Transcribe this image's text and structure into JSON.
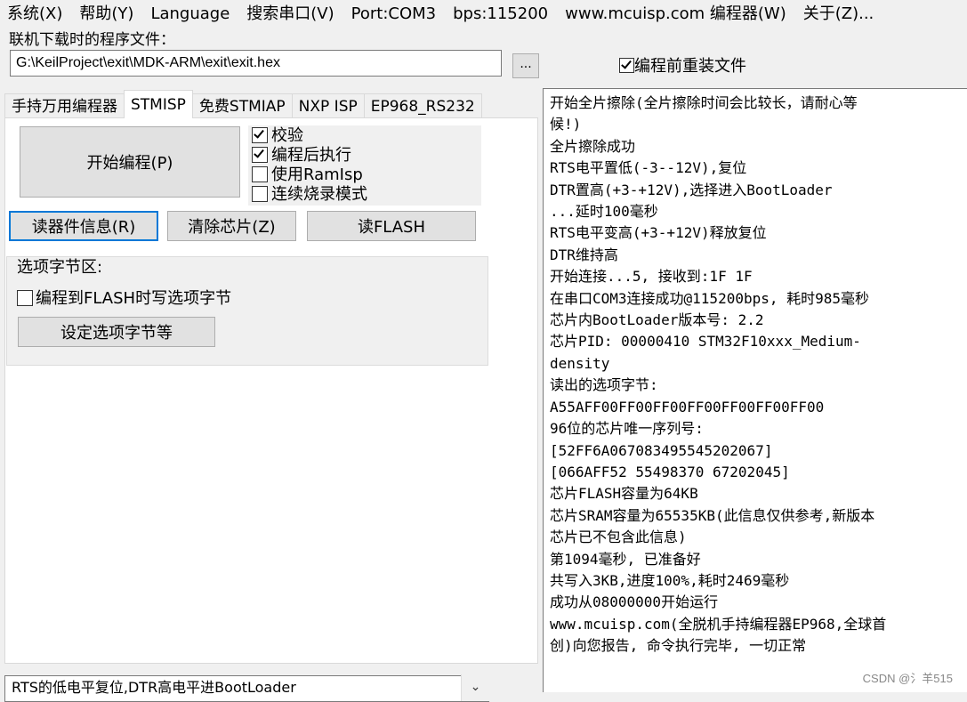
{
  "menu": [
    "系统(X)",
    "帮助(Y)",
    "Language",
    "搜索串口(V)",
    "Port:COM3",
    "bps:115200",
    "www.mcuisp.com 编程器(W)",
    "关于(Z)..."
  ],
  "file": {
    "label": "联机下载时的程序文件：",
    "path": "G:\\KeilProject\\exit\\MDK-ARM\\exit\\exit.hex",
    "browse_label": "...",
    "reload_label": "编程前重装文件",
    "reload_checked": true
  },
  "tabs": [
    {
      "label": "手持万用编程器",
      "active": false
    },
    {
      "label": "STMISP",
      "active": true
    },
    {
      "label": "免费STMIAP",
      "active": false
    },
    {
      "label": "NXP ISP",
      "active": false
    },
    {
      "label": "EP968_RS232",
      "active": false
    }
  ],
  "stmisp": {
    "start_label": "开始编程(P)",
    "options": [
      {
        "label": "校验",
        "checked": true
      },
      {
        "label": "编程后执行",
        "checked": true
      },
      {
        "label": "使用RamIsp",
        "checked": false
      },
      {
        "label": "连续烧录模式",
        "checked": false
      }
    ],
    "read_info_label": "读器件信息(R)",
    "erase_label": "清除芯片(Z)",
    "read_flash_label": "读FLASH",
    "option_group": {
      "title": "选项字节区:",
      "write_option_label": "编程到FLASH时写选项字节",
      "write_option_checked": false,
      "set_option_label": "设定选项字节等"
    }
  },
  "log_lines": [
    "开始全片擦除(全片擦除时间会比较长，请耐心等",
    "候!)",
    "全片擦除成功",
    "RTS电平置低(-3--12V),复位",
    "DTR置高(+3-+12V),选择进入BootLoader",
    "...延时100毫秒",
    "RTS电平变高(+3-+12V)释放复位",
    "DTR维持高",
    "开始连接...5, 接收到:1F 1F",
    "在串口COM3连接成功@115200bps, 耗时985毫秒",
    "芯片内BootLoader版本号: 2.2",
    "芯片PID: 00000410  STM32F10xxx_Medium-",
    "density",
    "读出的选项字节:",
    "A55AFF00FF00FF00FF00FF00FF00FF00",
    "96位的芯片唯一序列号:",
    "[52FF6A067083495545202067]",
    "[066AFF52 55498370 67202045]",
    "芯片FLASH容量为64KB",
    "芯片SRAM容量为65535KB(此信息仅供参考,新版本",
    "芯片已不包含此信息)",
    "第1094毫秒, 已准备好",
    "共写入3KB,进度100%,耗时2469毫秒",
    "成功从08000000开始运行",
    "www.mcuisp.com(全脱机手持编程器EP968,全球首",
    "创)向您报告, 命令执行完毕, 一切正常"
  ],
  "status_select": "RTS的低电平复位,DTR高电平进BootLoader",
  "watermark": "CSDN @氵羊515"
}
